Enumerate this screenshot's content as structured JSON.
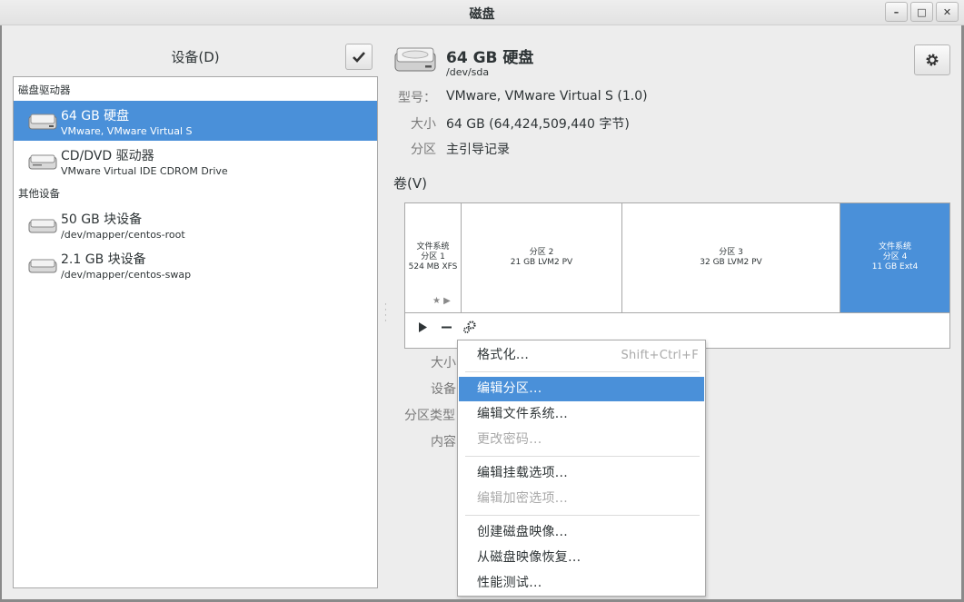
{
  "window": {
    "title": "磁盘",
    "minimize_label": "–",
    "maximize_label": "□",
    "close_label": "✕"
  },
  "left_pane": {
    "header": "设备(D)",
    "groups": [
      {
        "label": "磁盘驱动器",
        "items": [
          {
            "name": "64 GB 硬盘",
            "sub": "VMware, VMware Virtual S",
            "selected": true
          },
          {
            "name": "CD/DVD 驱动器",
            "sub": "VMware Virtual IDE CDROM Drive",
            "selected": false
          }
        ]
      },
      {
        "label": "其他设备",
        "items": [
          {
            "name": "50 GB 块设备",
            "sub": "/dev/mapper/centos-root",
            "selected": false
          },
          {
            "name": "2.1 GB 块设备",
            "sub": "/dev/mapper/centos-swap",
            "selected": false
          }
        ]
      }
    ]
  },
  "disk": {
    "title": "64 GB 硬盘",
    "path": "/dev/sda",
    "model_key": "型号：",
    "model_val": "VMware, VMware Virtual S (1.0)",
    "size_key": "大小",
    "size_val": "64 GB (64,424,509,440 字节)",
    "partitioning_key": "分区",
    "partitioning_val": "主引导记录"
  },
  "volumes": {
    "heading": "卷(V)",
    "partitions": [
      {
        "line1": "文件系统",
        "line2": "分区 1",
        "line3": "524 MB XFS",
        "selected": false
      },
      {
        "line1": "分区 2",
        "line2": "21 GB LVM2 PV",
        "line3": "",
        "selected": false
      },
      {
        "line1": "分区 3",
        "line2": "32 GB LVM2 PV",
        "line3": "",
        "selected": false
      },
      {
        "line1": "文件系统",
        "line2": "分区 4",
        "line3": "11 GB Ext4",
        "selected": true
      }
    ],
    "star_glyph": "★",
    "expand_glyph": "▶"
  },
  "properties": {
    "size_key": "大小",
    "device_key": "设备",
    "parttype_key": "分区类型",
    "contents_key": "内容"
  },
  "context_menu": {
    "items": [
      {
        "label": "格式化...",
        "accel": "Shift+Ctrl+F",
        "state": "normal"
      },
      {
        "label": "编辑分区...",
        "accel": "",
        "state": "highlighted"
      },
      {
        "label": "编辑文件系统...",
        "accel": "",
        "state": "normal"
      },
      {
        "label": "更改密码...",
        "accel": "",
        "state": "disabled"
      },
      {
        "label": "编辑挂载选项...",
        "accel": "",
        "state": "normal"
      },
      {
        "label": "编辑加密选项...",
        "accel": "",
        "state": "disabled"
      },
      {
        "label": "创建磁盘映像...",
        "accel": "",
        "state": "normal"
      },
      {
        "label": "从磁盘映像恢复...",
        "accel": "",
        "state": "normal"
      },
      {
        "label": "性能测试...",
        "accel": "",
        "state": "normal"
      }
    ]
  },
  "colors": {
    "selection": "#4a90d9",
    "background": "#ededed"
  }
}
